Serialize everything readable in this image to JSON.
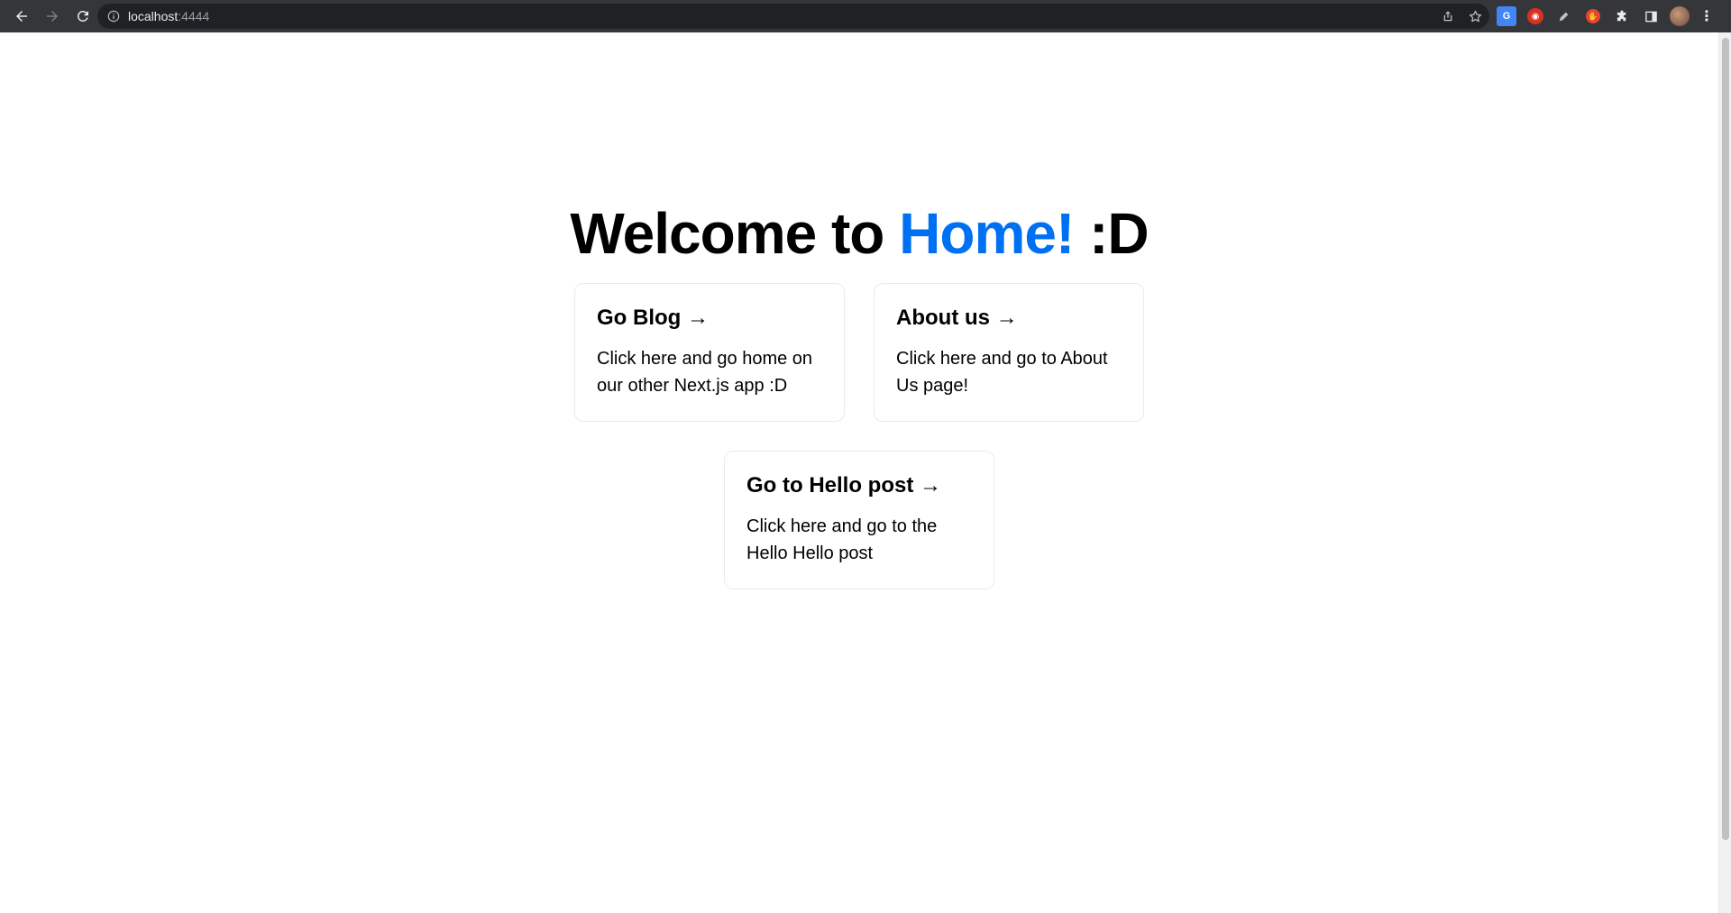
{
  "browser": {
    "url_host": "localhost",
    "url_port": ":4444"
  },
  "page": {
    "title_prefix": "Welcome to ",
    "title_accent": "Home!",
    "title_suffix": " :D",
    "accent_color": "#0070f3",
    "cards": [
      {
        "title": "Go Blog →",
        "description": "Click here and go home on our other Next.js app :D"
      },
      {
        "title": "About us →",
        "description": "Click here and go to About Us page!"
      },
      {
        "title": "Go to Hello post →",
        "description": "Click here and go to the Hello Hello post"
      }
    ]
  }
}
